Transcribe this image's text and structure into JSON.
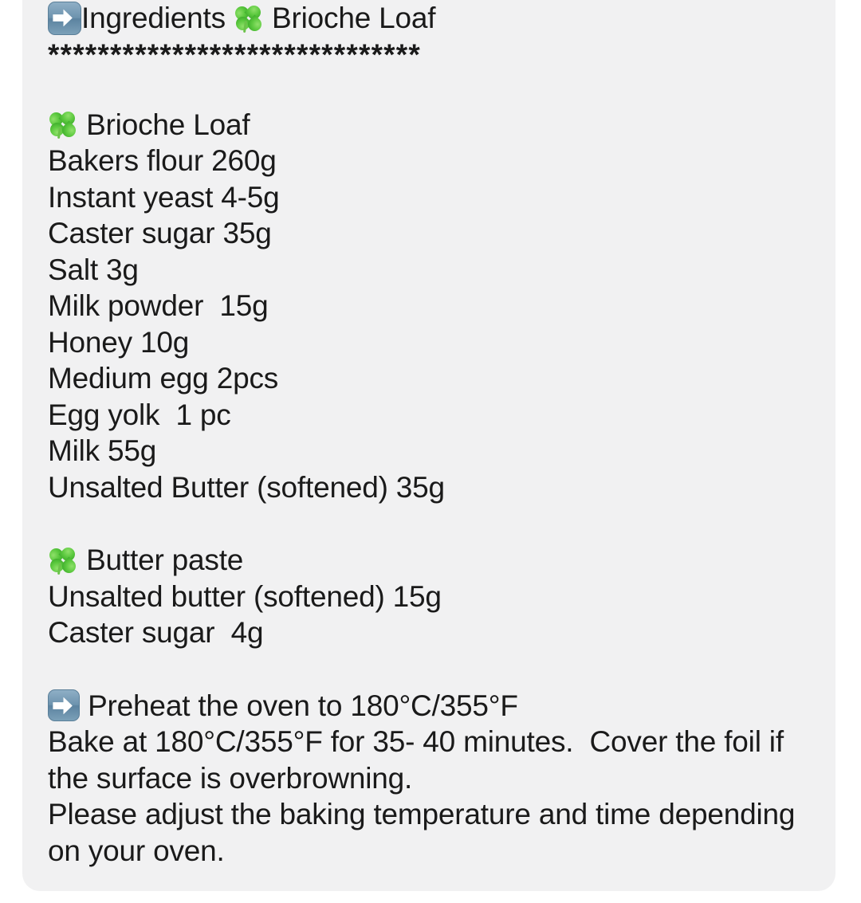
{
  "card": {
    "background_color": "#f1f1f2",
    "text_color": "#1a1a1a"
  },
  "header": {
    "arrow_icon": "right-arrow-emoji",
    "title": "Ingredients ",
    "clover_icon": "four-leaf-clover-emoji",
    "subtitle": " Brioche Loaf",
    "divider": "******************************"
  },
  "sections": [
    {
      "icon": "four-leaf-clover-emoji",
      "title": " Brioche Loaf",
      "items": [
        "Bakers flour 260g",
        "Instant yeast 4-5g",
        "Caster sugar 35g",
        "Salt 3g",
        "Milk powder  15g",
        "Honey 10g",
        "Medium egg 2pcs",
        "Egg yolk  1 pc",
        "Milk 55g",
        "Unsalted Butter (softened) 35g"
      ]
    },
    {
      "icon": "four-leaf-clover-emoji",
      "title": " Butter paste",
      "items": [
        "Unsalted butter (softened) 15g",
        "Caster sugar  4g"
      ]
    }
  ],
  "instructions": {
    "arrow_icon": "right-arrow-emoji",
    "preheat": " Preheat the oven to 180°C/355°F",
    "bake": "Bake at 180°C/355°F for 35- 40 minutes.  Cover the foil if the surface is overbrowning.",
    "note": "Please adjust the baking temperature and time depending on your oven."
  }
}
